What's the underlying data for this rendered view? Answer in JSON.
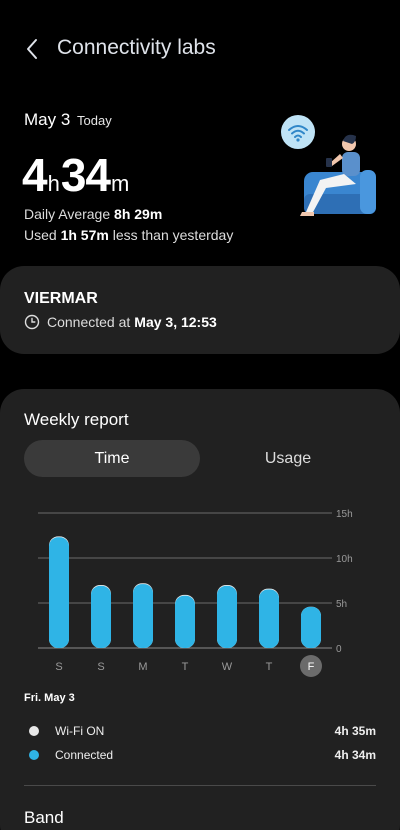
{
  "header": {
    "title": "Connectivity labs"
  },
  "summary": {
    "date": "May 3",
    "date_suffix": "Today",
    "hours": "4",
    "hours_unit": "h",
    "minutes": "34",
    "minutes_unit": "m",
    "avg_label": "Daily Average",
    "avg_value": "8h 29m",
    "used_prefix": "Used",
    "used_value": "1h 57m",
    "used_suffix": "less than yesterday"
  },
  "network": {
    "name": "VIERMAR",
    "status_label": "Connected at",
    "status_time": "May 3, 12:53"
  },
  "weekly": {
    "title": "Weekly report",
    "tabs": {
      "time": "Time",
      "usage": "Usage"
    },
    "selected_tab": "Time",
    "legend_date": "Fri. May 3",
    "legend": [
      {
        "label": "Wi-Fi ON",
        "value": "4h 35m",
        "color": "#e8e8e8"
      },
      {
        "label": "Connected",
        "value": "4h 34m",
        "color": "#2fb4e6"
      }
    ],
    "band_title": "Band"
  },
  "colors": {
    "bar": "#2fb4e6",
    "bar_cap": "#e8e8e8",
    "card": "#212121",
    "segment_active": "#3a3a3a"
  },
  "chart_data": {
    "type": "bar",
    "categories": [
      "S",
      "S",
      "M",
      "T",
      "W",
      "T",
      "F"
    ],
    "series": [
      {
        "name": "Wi-Fi ON",
        "values": [
          12.4,
          7.0,
          7.2,
          5.9,
          7.0,
          6.6,
          4.58
        ]
      },
      {
        "name": "Connected",
        "values": [
          12.3,
          6.9,
          7.1,
          5.8,
          6.9,
          6.5,
          4.57
        ]
      }
    ],
    "y_ticks": [
      "0",
      "5h",
      "10h",
      "15h"
    ],
    "ylim": [
      0,
      15
    ],
    "selected_index": 6,
    "grid": true
  }
}
